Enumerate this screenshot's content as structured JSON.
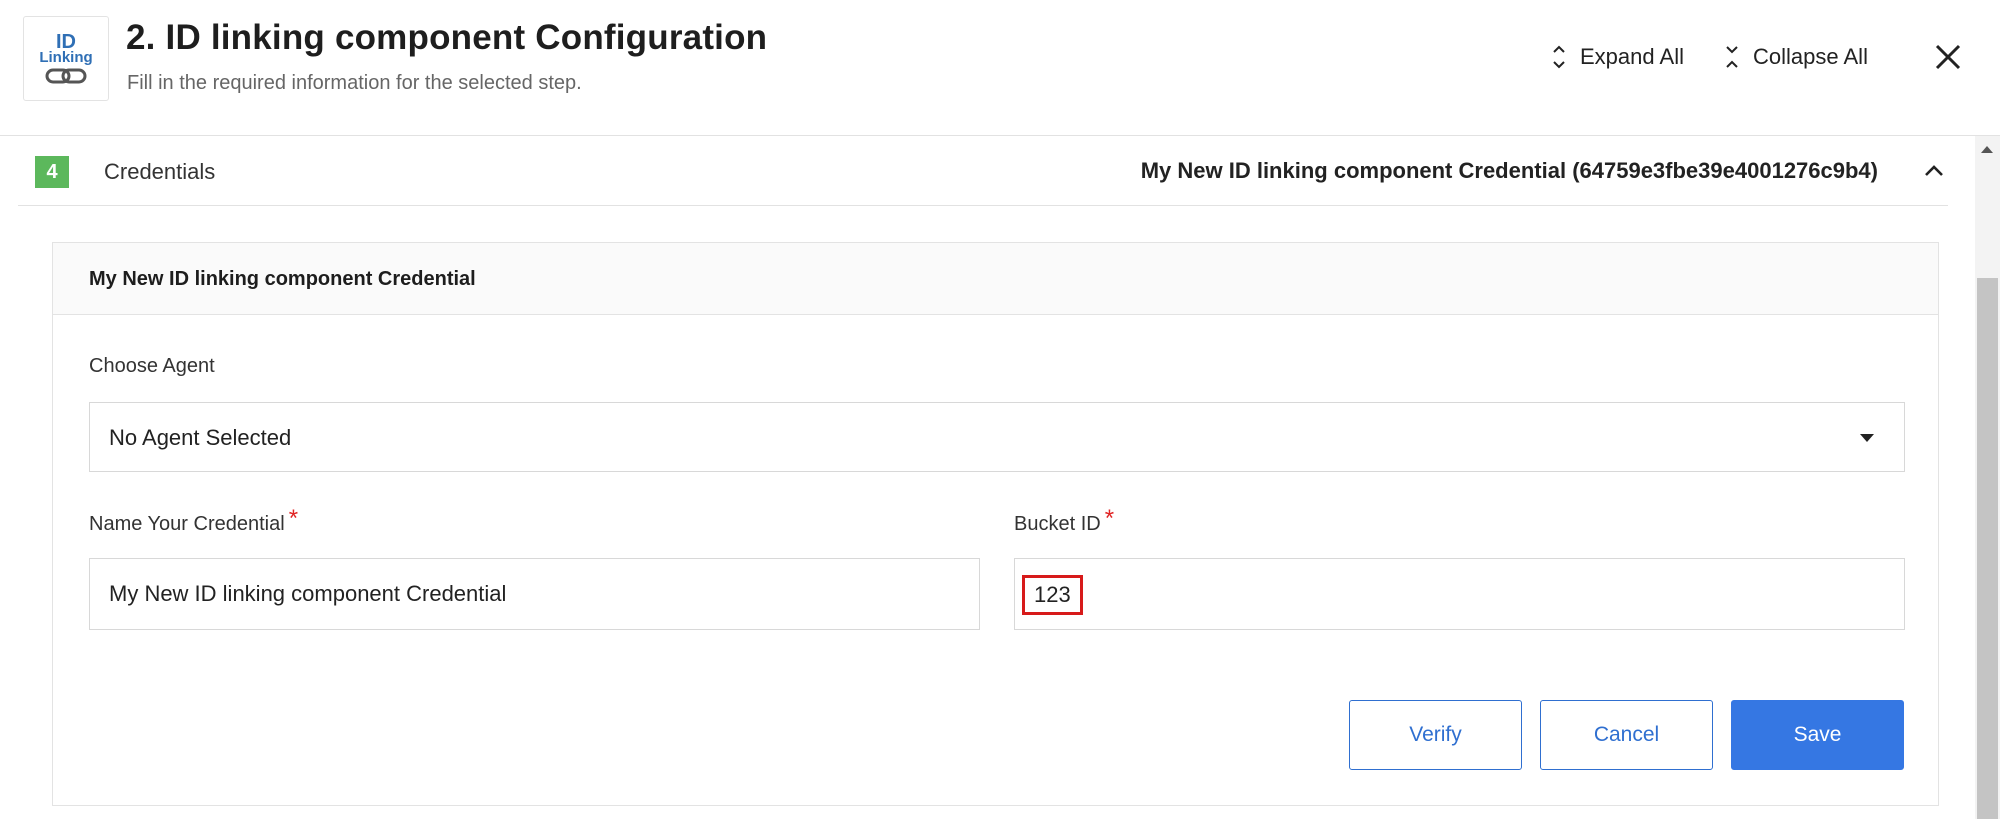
{
  "header": {
    "logo_top": "ID",
    "logo_bottom": "Linking",
    "title": "2. ID linking component Configuration",
    "subtitle": "Fill in the required information for the selected step.",
    "expand_all_label": "Expand All",
    "collapse_all_label": "Collapse All",
    "icons": {
      "expand": "expand-arrows-icon",
      "collapse": "collapse-arrows-icon",
      "close": "close-icon",
      "logo_chain": "chain-link-icon"
    }
  },
  "section": {
    "step_number": "4",
    "label": "Credentials",
    "selected_credential": "My New ID linking component Credential (64759e3fbe39e4001276c9b4)",
    "toggle_icon": "chevron-up-icon",
    "badge_color": "#5cb85c"
  },
  "card": {
    "title": "My New ID linking component Credential",
    "choose_agent_label": "Choose Agent",
    "agent_value": "No Agent Selected",
    "name_label": "Name Your Credential",
    "name_value": "My New ID linking component Credential",
    "bucket_label": "Bucket ID",
    "bucket_value": "123",
    "required_mark": "*",
    "buttons": {
      "verify": "Verify",
      "cancel": "Cancel",
      "save": "Save"
    }
  },
  "colors": {
    "primary": "#3577e3",
    "required": "#e02424",
    "highlight_border": "#d71a1a"
  }
}
